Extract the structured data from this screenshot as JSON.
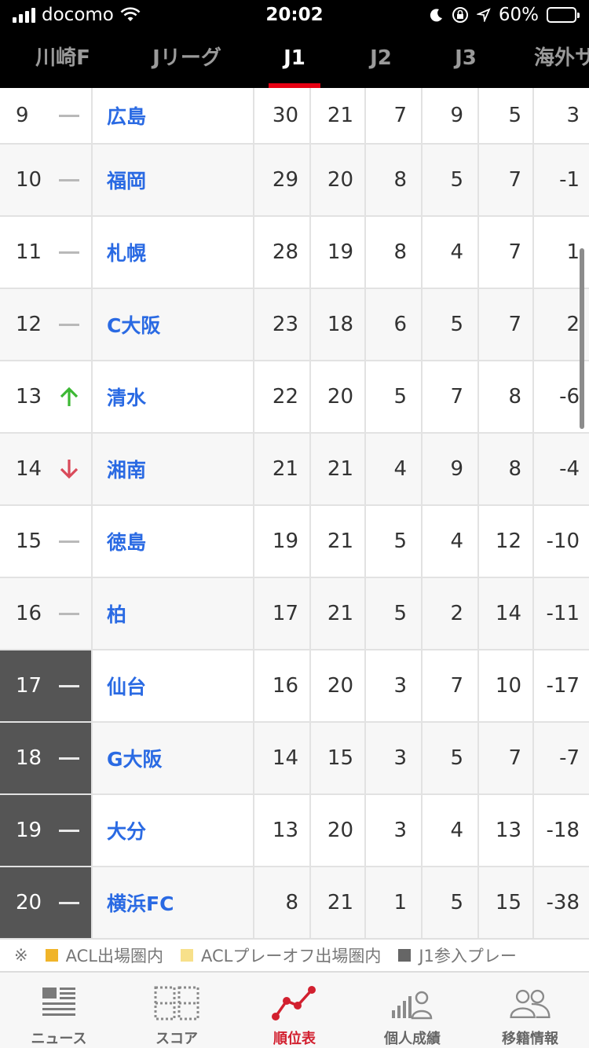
{
  "status_bar": {
    "carrier": "docomo",
    "time": "20:02",
    "battery": "60%",
    "battery_level": 0.6
  },
  "tabs": [
    {
      "label": "川崎F",
      "active": false
    },
    {
      "label": "Jリーグ",
      "active": false
    },
    {
      "label": "J1",
      "active": true
    },
    {
      "label": "J2",
      "active": false
    },
    {
      "label": "J3",
      "active": false
    },
    {
      "label": "海外サ",
      "active": false
    }
  ],
  "standings": [
    {
      "rank": "9",
      "trend": "same",
      "team": "広島",
      "pts": "30",
      "gp": "21",
      "w": "7",
      "d": "9",
      "l": "5",
      "gd": "3",
      "zone": "normal"
    },
    {
      "rank": "10",
      "trend": "same",
      "team": "福岡",
      "pts": "29",
      "gp": "20",
      "w": "8",
      "d": "5",
      "l": "7",
      "gd": "-1",
      "zone": "normal"
    },
    {
      "rank": "11",
      "trend": "same",
      "team": "札幌",
      "pts": "28",
      "gp": "19",
      "w": "8",
      "d": "4",
      "l": "7",
      "gd": "1",
      "zone": "normal"
    },
    {
      "rank": "12",
      "trend": "same",
      "team": "C大阪",
      "pts": "23",
      "gp": "18",
      "w": "6",
      "d": "5",
      "l": "7",
      "gd": "2",
      "zone": "normal"
    },
    {
      "rank": "13",
      "trend": "up",
      "team": "清水",
      "pts": "22",
      "gp": "20",
      "w": "5",
      "d": "7",
      "l": "8",
      "gd": "-6",
      "zone": "normal"
    },
    {
      "rank": "14",
      "trend": "down",
      "team": "湘南",
      "pts": "21",
      "gp": "21",
      "w": "4",
      "d": "9",
      "l": "8",
      "gd": "-4",
      "zone": "normal"
    },
    {
      "rank": "15",
      "trend": "same",
      "team": "徳島",
      "pts": "19",
      "gp": "21",
      "w": "5",
      "d": "4",
      "l": "12",
      "gd": "-10",
      "zone": "normal"
    },
    {
      "rank": "16",
      "trend": "same",
      "team": "柏",
      "pts": "17",
      "gp": "21",
      "w": "5",
      "d": "2",
      "l": "14",
      "gd": "-11",
      "zone": "normal"
    },
    {
      "rank": "17",
      "trend": "same",
      "team": "仙台",
      "pts": "16",
      "gp": "20",
      "w": "3",
      "d": "7",
      "l": "10",
      "gd": "-17",
      "zone": "relegation"
    },
    {
      "rank": "18",
      "trend": "same",
      "team": "G大阪",
      "pts": "14",
      "gp": "15",
      "w": "3",
      "d": "5",
      "l": "7",
      "gd": "-7",
      "zone": "relegation"
    },
    {
      "rank": "19",
      "trend": "same",
      "team": "大分",
      "pts": "13",
      "gp": "20",
      "w": "3",
      "d": "4",
      "l": "13",
      "gd": "-18",
      "zone": "relegation"
    },
    {
      "rank": "20",
      "trend": "same",
      "team": "横浜FC",
      "pts": "8",
      "gp": "21",
      "w": "1",
      "d": "5",
      "l": "15",
      "gd": "-38",
      "zone": "relegation"
    }
  ],
  "legend": {
    "prefix": "※",
    "items": [
      {
        "label": "ACL出場圏内",
        "color": "#f0b429"
      },
      {
        "label": "ACLプレーオフ出場圏内",
        "color": "#f7e08a"
      },
      {
        "label": "J1参入プレー",
        "color": "#666666"
      }
    ]
  },
  "bottom_nav": [
    {
      "label": "ニュース",
      "icon": "news-icon",
      "active": false
    },
    {
      "label": "スコア",
      "icon": "scoreboard-icon",
      "active": false
    },
    {
      "label": "順位表",
      "icon": "standings-chart-icon",
      "active": true
    },
    {
      "label": "個人成績",
      "icon": "player-stats-icon",
      "active": false
    },
    {
      "label": "移籍情報",
      "icon": "transfer-people-icon",
      "active": false
    }
  ],
  "colors": {
    "accent": "#d2202f",
    "team_link": "#2a6ae3",
    "relegation_zone": "#555555",
    "trend_up": "#3cb834",
    "trend_down": "#d94a5a"
  }
}
